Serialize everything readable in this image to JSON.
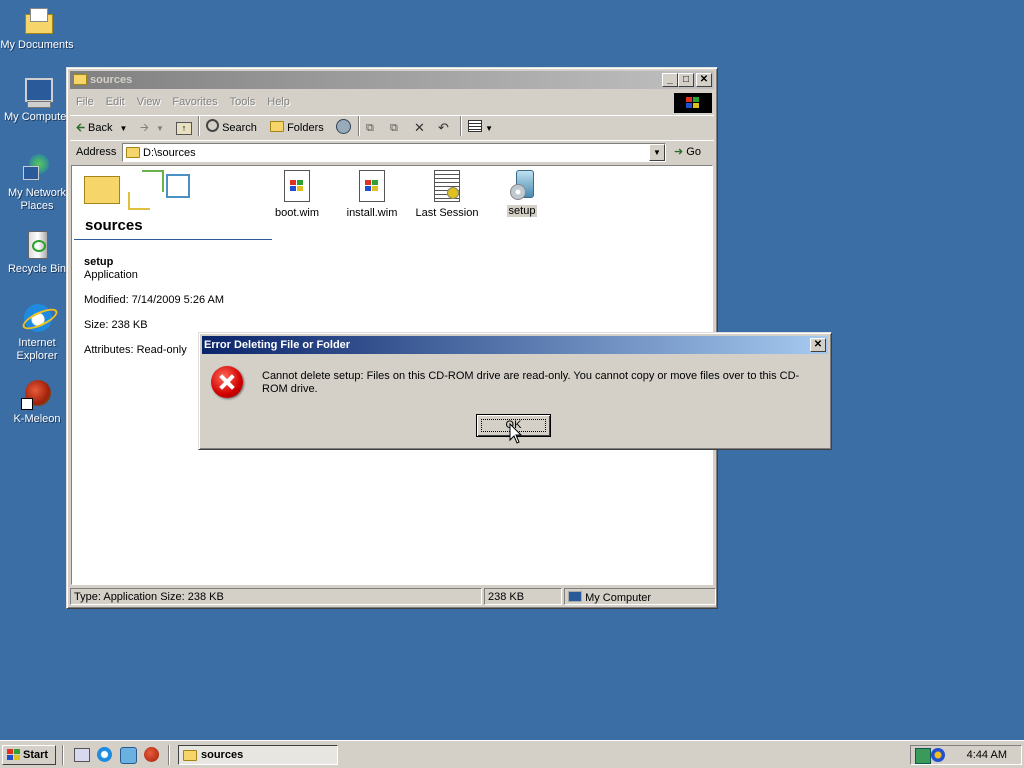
{
  "desktop": {
    "icons": [
      {
        "label": "My Documents"
      },
      {
        "label": "My Computer"
      },
      {
        "label": "My Network Places"
      },
      {
        "label": "Recycle Bin"
      },
      {
        "label": "Internet Explorer"
      },
      {
        "label": "K-Meleon"
      }
    ]
  },
  "window": {
    "title": "sources",
    "menu": [
      "File",
      "Edit",
      "View",
      "Favorites",
      "Tools",
      "Help"
    ],
    "toolbar": {
      "back": "Back",
      "search": "Search",
      "folders": "Folders"
    },
    "address": {
      "label": "Address",
      "value": "D:\\sources",
      "go": "Go"
    },
    "panel": {
      "folder_name": "sources",
      "selected_name": "setup",
      "selected_type": "Application",
      "modified": "Modified: 7/14/2009 5:26 AM",
      "size": "Size: 238 KB",
      "attributes": "Attributes: Read-only"
    },
    "files": [
      {
        "name": "boot.wim"
      },
      {
        "name": "install.wim"
      },
      {
        "name": "Last Session"
      },
      {
        "name": "setup"
      }
    ],
    "status": {
      "info": "Type: Application Size: 238 KB",
      "size": "238 KB",
      "zone": "My Computer"
    }
  },
  "dialog": {
    "title": "Error Deleting File or Folder",
    "message": "Cannot delete setup: Files on this CD-ROM drive are read-only.  You cannot copy or move files over to this CD-ROM drive.",
    "ok": "OK"
  },
  "taskbar": {
    "start": "Start",
    "task": "sources",
    "clock": "4:44 AM"
  }
}
